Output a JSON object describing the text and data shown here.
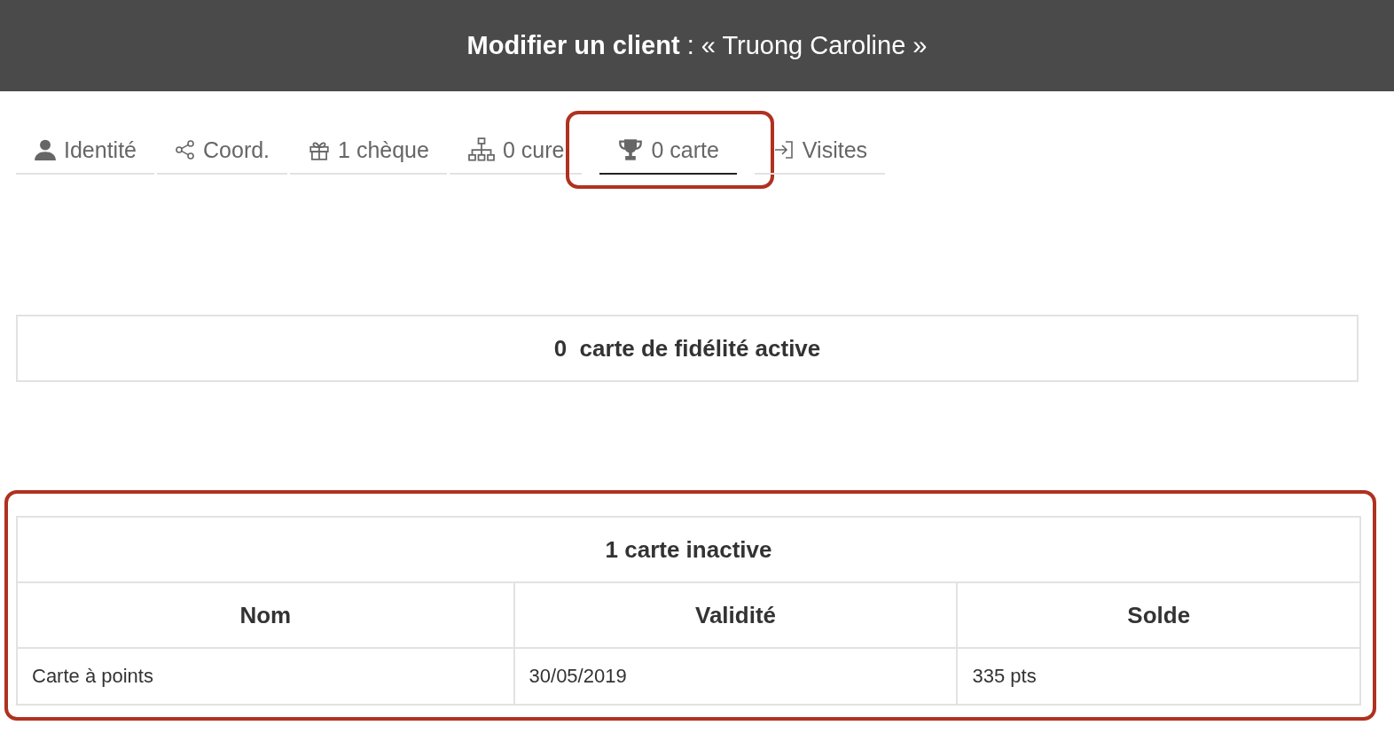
{
  "header": {
    "title_bold": "Modifier un client",
    "title_rest": " : « Truong Caroline »"
  },
  "tabs": [
    {
      "kind": "person",
      "label": "Identité",
      "selected": false,
      "highlighted": false
    },
    {
      "kind": "share",
      "label": "Coord.",
      "selected": false,
      "highlighted": false
    },
    {
      "kind": "gift",
      "label": "1 chèque",
      "selected": false,
      "highlighted": false
    },
    {
      "kind": "sitemap",
      "label": "0 cure",
      "selected": false,
      "highlighted": false
    },
    {
      "kind": "trophy",
      "label": "0 carte",
      "selected": true,
      "highlighted": true
    },
    {
      "kind": "signin",
      "label": "Visites",
      "selected": false,
      "highlighted": false
    }
  ],
  "active_panel": {
    "title": "0  carte de fidélité active"
  },
  "inactive_panel": {
    "title": "1 carte inactive",
    "highlighted": true,
    "columns": [
      "Nom",
      "Validité",
      "Solde"
    ],
    "rows": [
      [
        "Carte à points",
        "30/05/2019",
        "335 pts"
      ]
    ]
  }
}
